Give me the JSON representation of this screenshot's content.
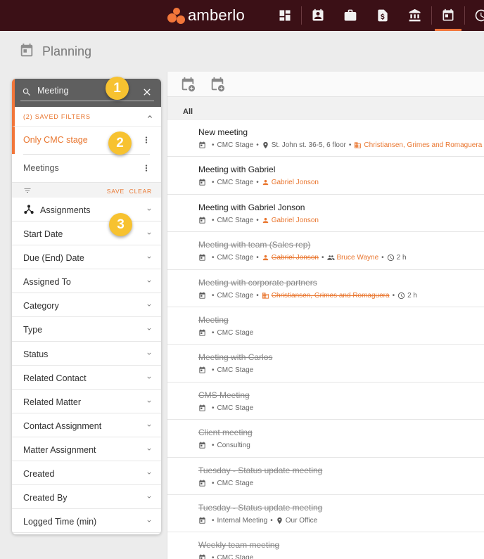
{
  "app": {
    "logo_text": "amberlo"
  },
  "nav": {
    "items": [
      {
        "icon": "dashboard-icon",
        "active": false
      },
      {
        "icon": "contacts-icon",
        "active": false
      },
      {
        "icon": "briefcase-icon",
        "active": false
      },
      {
        "icon": "invoice-icon",
        "active": false
      },
      {
        "icon": "bank-icon",
        "active": false
      },
      {
        "icon": "calendar-icon",
        "active": true
      },
      {
        "icon": "time-icon",
        "active": false
      }
    ]
  },
  "header": {
    "title": "Planning"
  },
  "search": {
    "value": "Meeting",
    "placeholder": ""
  },
  "saved_filters": {
    "header": "(2) SAVED FILTERS",
    "items": [
      {
        "label": "Only CMC stage",
        "active": true
      },
      {
        "label": "Meetings",
        "active": false
      }
    ]
  },
  "filter_bar": {
    "save": "SAVE",
    "clear": "CLEAR"
  },
  "filters": [
    "Assignments",
    "Start Date",
    "Due (End) Date",
    "Assigned To",
    "Category",
    "Type",
    "Status",
    "Related Contact",
    "Related Matter",
    "Contact Assignment",
    "Matter Assignment",
    "Created",
    "Created By",
    "Logged Time (min)"
  ],
  "badges": [
    "1",
    "2",
    "3"
  ],
  "main": {
    "group": "All",
    "meetings": [
      {
        "title": "New meeting",
        "done": false,
        "type": "CMC Stage",
        "location": "St. John st. 36-5, 6 floor",
        "company": "Christiansen, Grimes and Romaguera"
      },
      {
        "title": "Meeting with Gabriel",
        "done": false,
        "type": "CMC Stage",
        "person": "Gabriel Jonson"
      },
      {
        "title": "Meeting with Gabriel Jonson",
        "done": false,
        "type": "CMC Stage",
        "person": "Gabriel Jonson"
      },
      {
        "title": "Meeting with team (Sales rep)",
        "done": true,
        "type": "CMC Stage",
        "person": "Gabriel Jonson",
        "group": "Bruce Wayne",
        "duration": "2 h"
      },
      {
        "title": "Meeting with corporate partners",
        "done": true,
        "type": "CMC Stage",
        "company": "Christiansen, Grimes and Romaguera",
        "duration": "2 h"
      },
      {
        "title": "Meeting",
        "done": true,
        "type": "CMC Stage"
      },
      {
        "title": "Meeting with Carlos",
        "done": true,
        "type": "CMC Stage"
      },
      {
        "title": "CMS Meeting",
        "done": true,
        "type": "CMC Stage"
      },
      {
        "title": "Client meeting",
        "done": true,
        "type": "Consulting"
      },
      {
        "title": "Tuesday - Status update meeting",
        "done": true,
        "type": "CMC Stage"
      },
      {
        "title": "Tuesday - Status update meeting",
        "done": true,
        "type": "Internal Meeting",
        "location": "Our Office"
      },
      {
        "title": "Weekly team meeting",
        "done": true,
        "type": "CMC Stage"
      }
    ]
  }
}
